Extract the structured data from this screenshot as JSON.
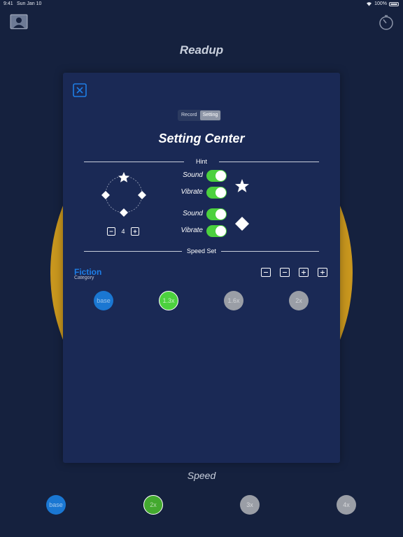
{
  "status_bar": {
    "time": "9:41",
    "date": "Sun Jan 10",
    "battery": "100%"
  },
  "app": {
    "title": "Readup"
  },
  "tabs": [
    {
      "label": "Record",
      "active": false
    },
    {
      "label": "Setting",
      "active": true
    }
  ],
  "modal": {
    "title": "Setting Center"
  },
  "hint": {
    "section_label": "Hint",
    "count": "4",
    "star_sound_label": "Sound",
    "star_sound_on": true,
    "star_vibrate_label": "Vibrate",
    "star_vibrate_on": true,
    "diamond_sound_label": "Sound",
    "diamond_sound_on": true,
    "diamond_vibrate_label": "Vibrate",
    "diamond_vibrate_on": true
  },
  "speed_set": {
    "section_label": "Speed Set",
    "category_name": "Fiction",
    "category_label": "Category",
    "options": [
      "base",
      "1.3x",
      "1.6x",
      "2x"
    ],
    "selected": "1.3x"
  },
  "bottom": {
    "label": "Speed",
    "options": [
      "base",
      "2x",
      "3x",
      "4x"
    ],
    "selected": "2x"
  },
  "colors": {
    "background": "#15213e",
    "modal": "#1a2955",
    "accent_blue": "#1a77d2",
    "toggle_green": "#4cd13e",
    "yellow": "#c8961e"
  },
  "icons": [
    "profile-icon",
    "timer-icon",
    "close-icon",
    "star-icon",
    "diamond-icon",
    "minus-icon",
    "plus-icon"
  ]
}
